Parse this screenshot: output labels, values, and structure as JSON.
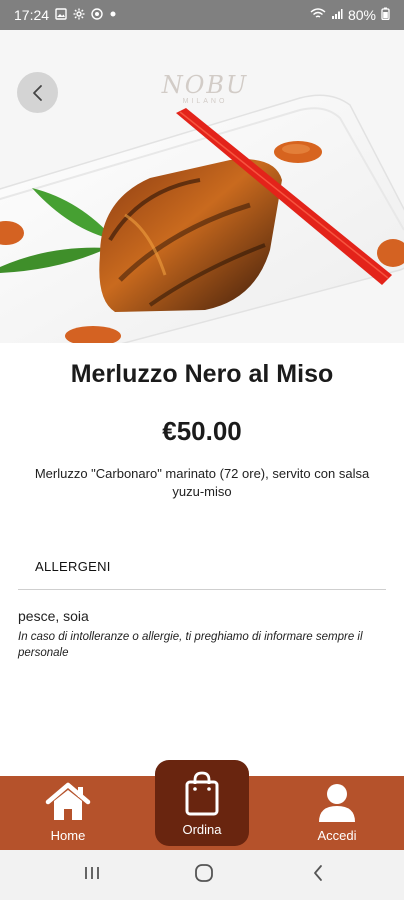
{
  "status_bar": {
    "time": "17:24",
    "battery": "80%",
    "icons": [
      "gallery-icon",
      "settings-icon",
      "vpn-icon",
      "dot-icon",
      "wifi-icon",
      "signal-icon",
      "battery-icon"
    ]
  },
  "header": {
    "back_icon": "chevron-left-icon",
    "logo_text": "NOBU",
    "logo_subtext": "MILANO"
  },
  "product": {
    "title": "Merluzzo Nero al Miso",
    "price": "€50.00",
    "description": "Merluzzo \"Carbonaro\" marinato (72 ore), servito con salsa yuzu-miso"
  },
  "allergens": {
    "header": "ALLERGENI",
    "list": "pesce, soia",
    "note": "In caso di intolleranze o allergie, ti preghiamo di informare sempre il personale"
  },
  "bottom_nav": {
    "items": [
      {
        "label": "Home",
        "icon": "home-icon"
      },
      {
        "label": "Ordina",
        "icon": "shopping-bag-icon"
      },
      {
        "label": "Accedi",
        "icon": "user-icon"
      }
    ]
  },
  "system_nav": {
    "buttons": [
      "recents-icon",
      "home-circle-icon",
      "back-icon"
    ]
  },
  "colors": {
    "nav_background": "#b5522b",
    "nav_center": "#69250f",
    "status_bar": "#808080"
  }
}
